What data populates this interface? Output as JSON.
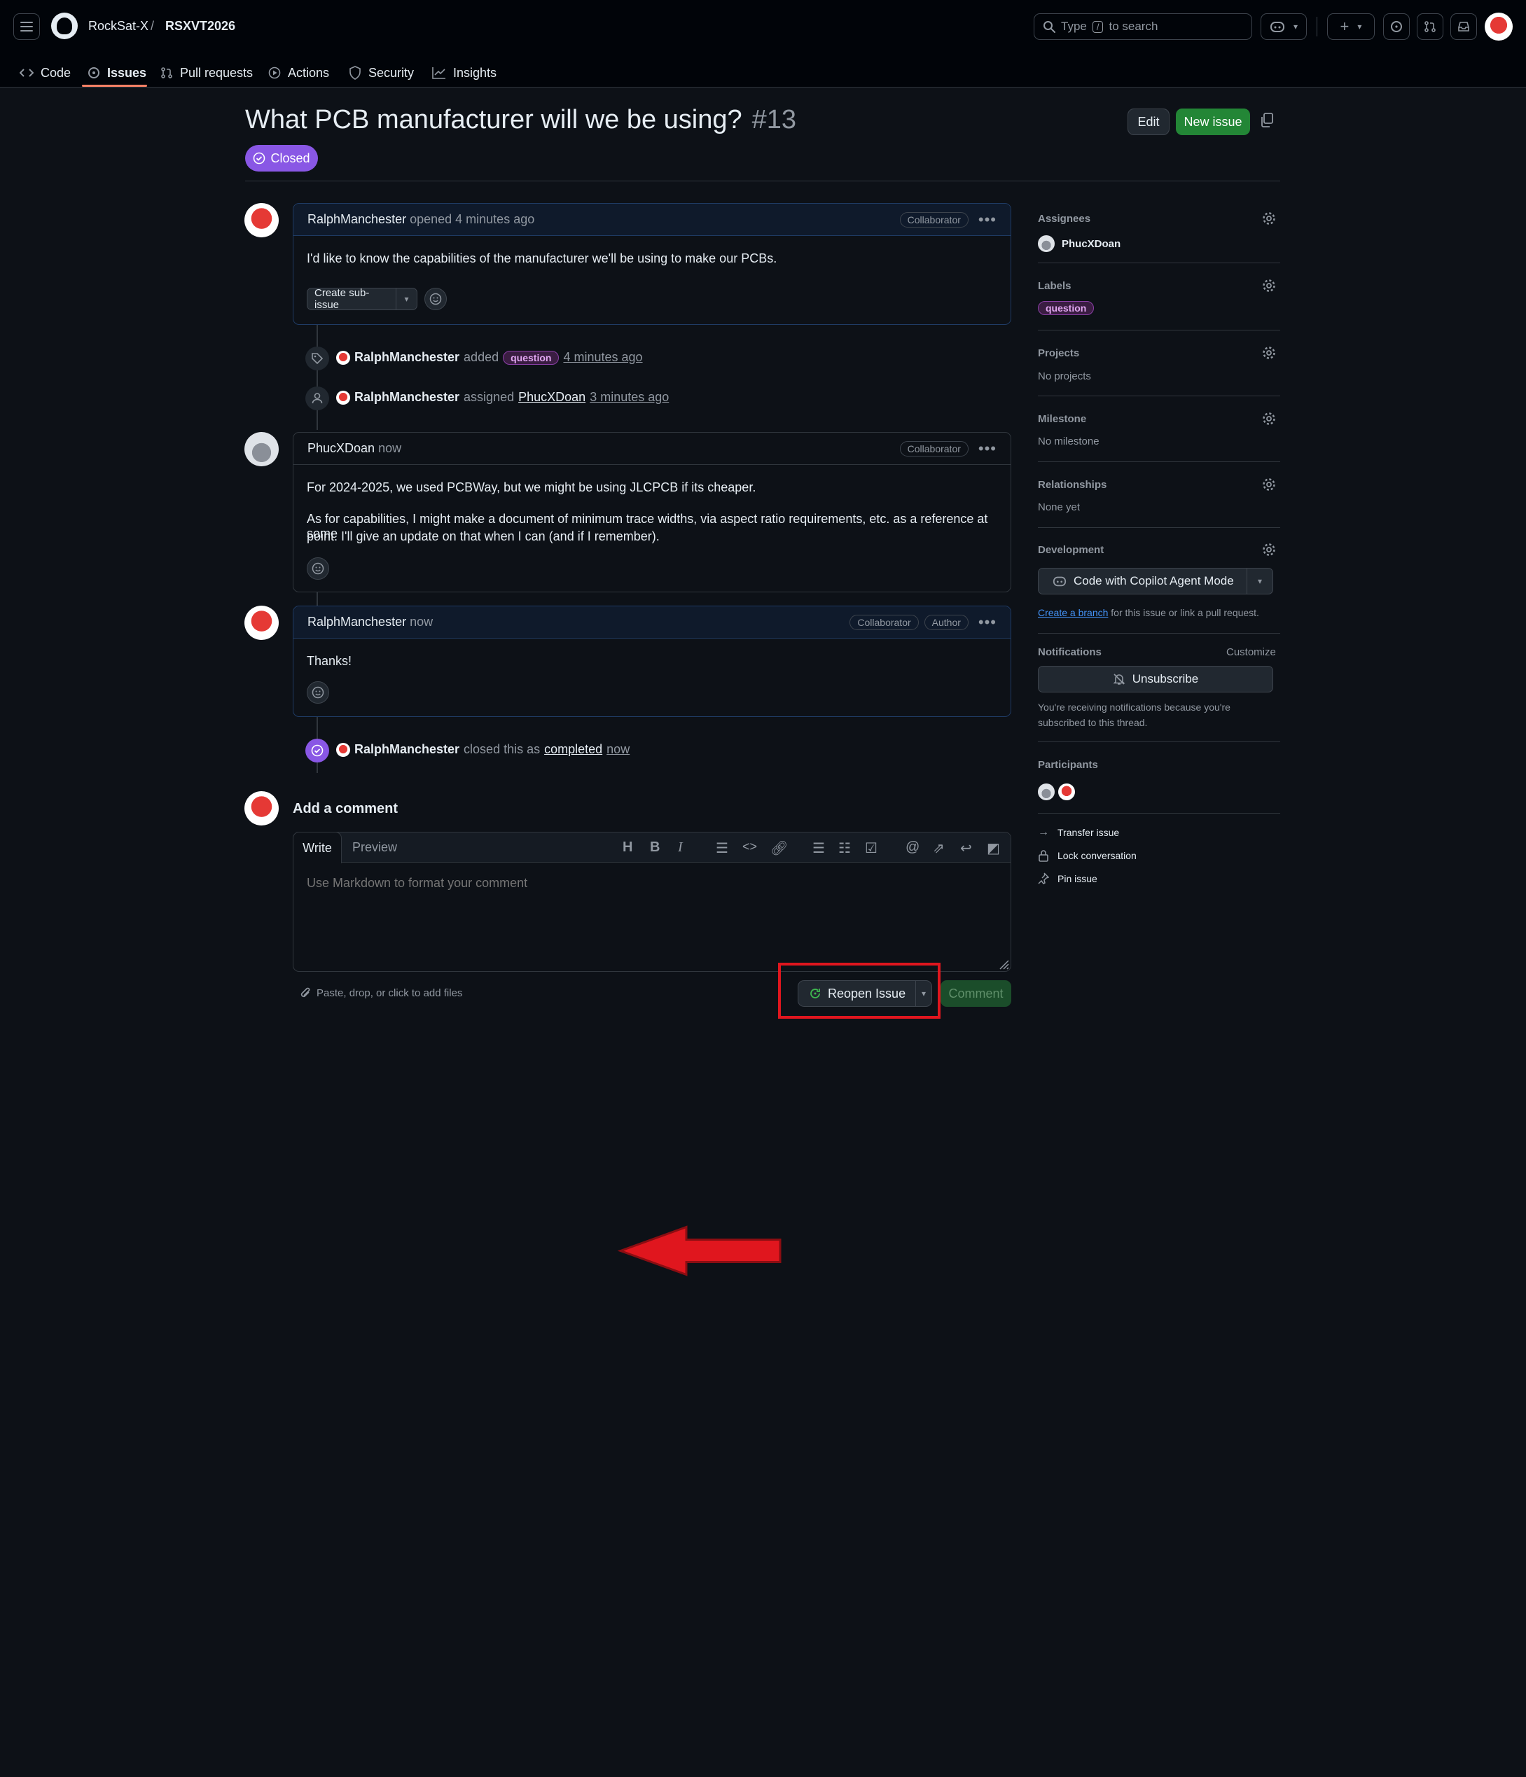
{
  "header": {
    "org": "RockSat-X",
    "separator": "/",
    "repo": "RSXVT2026",
    "search_placeholder_pre": "Type",
    "search_key": "/",
    "search_placeholder_post": "to search"
  },
  "repo_tabs": [
    {
      "label": "Code",
      "icon": "code-icon",
      "active": false
    },
    {
      "label": "Issues",
      "icon": "issue-icon",
      "active": true
    },
    {
      "label": "Pull requests",
      "icon": "pull-request-icon",
      "active": false
    },
    {
      "label": "Actions",
      "icon": "play-icon",
      "active": false
    },
    {
      "label": "Security",
      "icon": "shield-icon",
      "active": false
    },
    {
      "label": "Insights",
      "icon": "graph-icon",
      "active": false
    }
  ],
  "issue": {
    "title": "What PCB manufacturer will we be using?",
    "number": "#13",
    "state": "Closed",
    "edit_label": "Edit",
    "new_issue_label": "New issue"
  },
  "comments": [
    {
      "author": "RalphManchester",
      "meta_verb": "opened",
      "time": "4 minutes ago",
      "badges": [
        "Collaborator"
      ],
      "body": [
        "I'd like to know the capabilities of the manufacturer we'll be using to make our PCBs."
      ],
      "action_label": "Create sub-issue"
    },
    {
      "author": "PhucXDoan",
      "time": "now",
      "badges": [
        "Collaborator"
      ],
      "body": [
        "For 2024-2025, we used PCBWay, but we might be using JLCPCB if its cheaper.",
        "As for capabilities, I might make a document of minimum trace widths, via aspect ratio requirements, etc. as a reference at some",
        "point. I'll give an update on that when I can (and if I remember)."
      ]
    },
    {
      "author": "RalphManchester",
      "time": "now",
      "badges": [
        "Collaborator",
        "Author"
      ],
      "body": [
        "Thanks!"
      ]
    }
  ],
  "events": [
    {
      "actor": "RalphManchester",
      "verb": "added",
      "label": "question",
      "time": "4 minutes ago"
    },
    {
      "actor": "RalphManchester",
      "verb": "assigned",
      "target": "PhucXDoan",
      "time": "3 minutes ago"
    },
    {
      "actor": "RalphManchester",
      "verb": "closed this as",
      "target": "completed",
      "time": "now"
    }
  ],
  "composer": {
    "heading": "Add a comment",
    "tab_write": "Write",
    "tab_preview": "Preview",
    "placeholder": "Use Markdown to format your comment",
    "attach_hint": "Paste, drop, or click to add files",
    "reopen_label": "Reopen Issue",
    "comment_label": "Comment"
  },
  "sidebar": {
    "assignees_title": "Assignees",
    "assignee": "PhucXDoan",
    "labels_title": "Labels",
    "label": "question",
    "projects_title": "Projects",
    "projects_value": "No projects",
    "milestone_title": "Milestone",
    "milestone_value": "No milestone",
    "relationships_title": "Relationships",
    "relationships_value": "None yet",
    "development_title": "Development",
    "copilot_label": "Code with Copilot Agent Mode",
    "create_branch_link": "Create a branch",
    "create_branch_suffix": "for this issue or link a pull request.",
    "notifications_title": "Notifications",
    "customize_label": "Customize",
    "unsubscribe_label": "Unsubscribe",
    "notif_text_1": "You're receiving notifications because you're",
    "notif_text_2": "subscribed to this thread.",
    "participants_title": "Participants",
    "transfer_label": "Transfer issue",
    "lock_label": "Lock conversation",
    "pin_label": "Pin issue"
  },
  "colors": {
    "closed_purple": "#8957e5",
    "green_button": "#238636",
    "annotation_red": "#e0161e",
    "label_bg": "#3a1d42"
  }
}
